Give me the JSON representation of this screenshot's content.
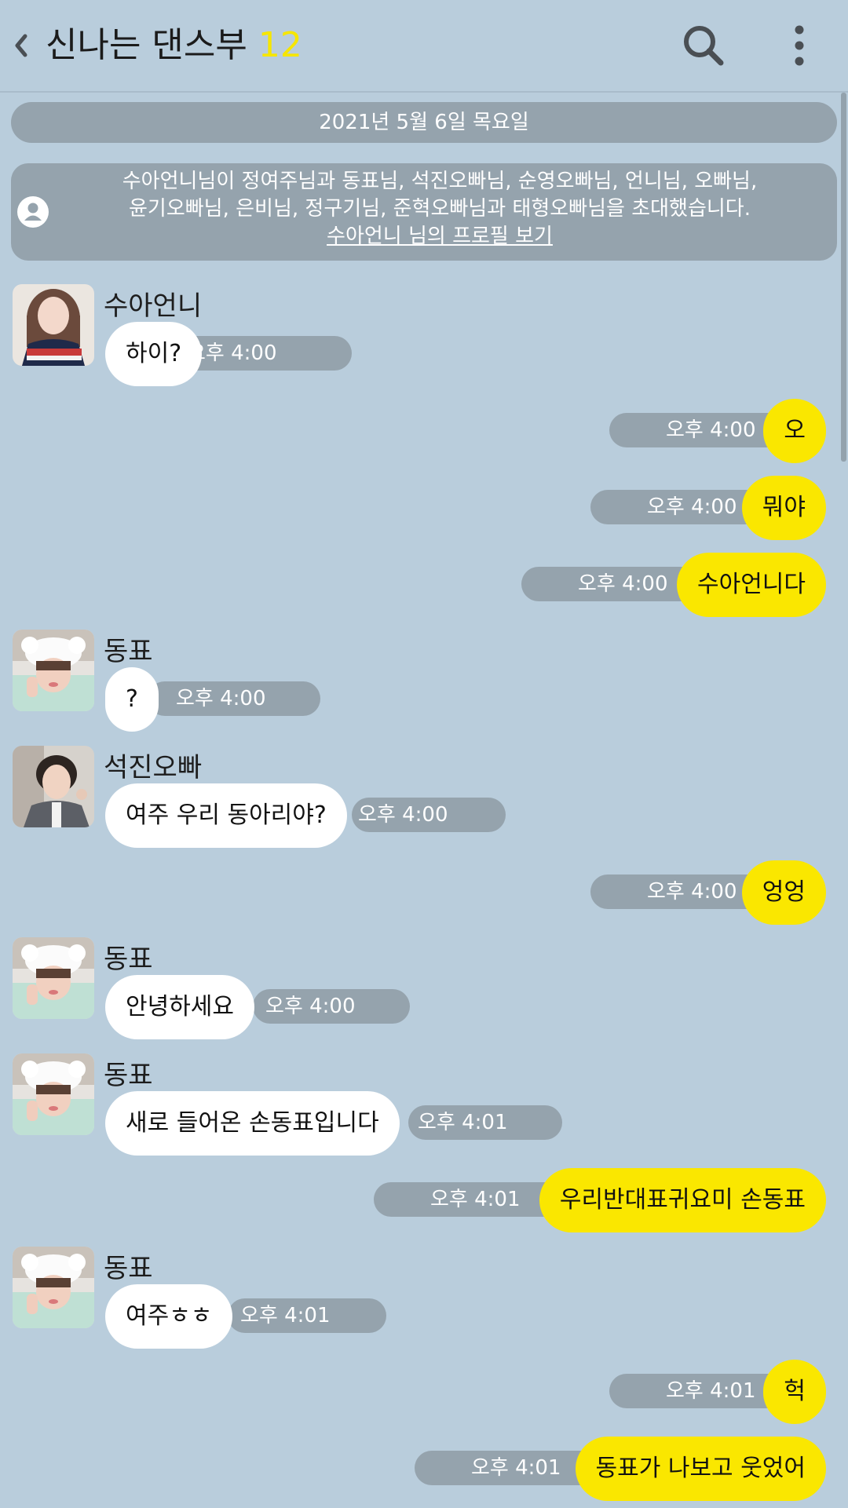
{
  "header": {
    "title": "신나는 댄스부",
    "member_count": "12",
    "back_icon": "chevron-left-icon",
    "search_icon": "search-icon",
    "menu_icon": "more-vertical-icon"
  },
  "date_divider": "2021년 5월 6일 목요일",
  "invite_notice": {
    "line1": "수아언니님이 정여주님과 동표님, 석진오빠님, 순영오빠님, 언니님, 오빠님,",
    "line2": "윤기오빠님, 은비님, 정구기님, 준혁오빠님과 태형오빠님을 초대했습니다.",
    "link": "수아언니 님의 프로필 보기",
    "icon": "user-icon"
  },
  "colors": {
    "background": "#b9cddc",
    "incoming_bubble": "#ffffff",
    "outgoing_bubble": "#fae700",
    "meta_pill": "#95a3ad",
    "member_count": "#f6e600"
  },
  "messages": [
    {
      "sender": "수아언니",
      "text": "하이?",
      "time": "오후 4:00"
    },
    {
      "text": "오",
      "time": "오후 4:00"
    },
    {
      "text": "뭐야",
      "time": "오후 4:00"
    },
    {
      "text": "수아언니다",
      "time": "오후 4:00"
    },
    {
      "sender": "동표",
      "text": "?",
      "time": "오후 4:00"
    },
    {
      "sender": "석진오빠",
      "text": "여주 우리 동아리야?",
      "time": "오후 4:00"
    },
    {
      "text": "엉엉",
      "time": "오후 4:00"
    },
    {
      "sender": "동표",
      "text": "안녕하세요",
      "time": "오후 4:00"
    },
    {
      "sender": "동표",
      "text": "새로 들어온 손동표입니다",
      "time": "오후 4:01"
    },
    {
      "text": "우리반대표귀요미 손동표",
      "time": "오후 4:01"
    },
    {
      "sender": "동표",
      "text": "여주ㅎㅎ",
      "time": "오후 4:01"
    },
    {
      "text": "헉",
      "time": "오후 4:01"
    },
    {
      "text": "동표가 나보고 웃었어",
      "time": "오후 4:01"
    }
  ]
}
